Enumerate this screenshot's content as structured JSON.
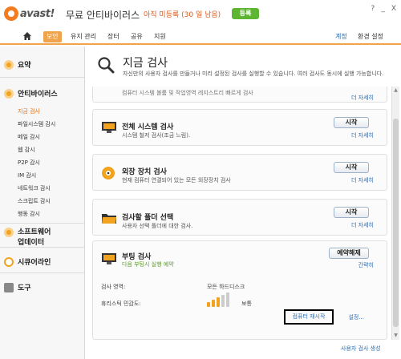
{
  "titlebar": {
    "logo_text": "avast!",
    "app_title": "무료 안티바이러스",
    "trial_text": "아직 미등록 (30 일 남음)",
    "register_label": "등록",
    "win_buttons": [
      "?",
      "_",
      "X"
    ]
  },
  "nav": {
    "items": [
      "보안",
      "유지 관리",
      "장터",
      "공유",
      "지원"
    ],
    "right_links": [
      "계정",
      "환경 설정"
    ]
  },
  "sidebar": {
    "summary_label": "요약",
    "antivirus_label": "안티바이러스",
    "antivirus_items": [
      "지금 검사",
      "파일시스템 감시",
      "메일 감시",
      "웹 감시",
      "P2P 감시",
      "IM 감시",
      "네트워크 감시",
      "스크립트 감시",
      "행동 감시"
    ],
    "software_update_label_1": "소프트웨어",
    "software_update_label_2": "업데이터",
    "sandbox_label": "시큐어라인",
    "tools_label": "도구"
  },
  "main": {
    "title": "지금 검사",
    "description": "자신만의 사용자 검사를 만들거나 미리 설정된 검사를 실행할 수 있습니다. 여러 검사도 동시에 실행 가능합니다.",
    "partial_card_text": "컴퓨터 시스템 볼륨 및 작업영역 레지스트리 빠르게 검사",
    "partial_card_link": "더 자세히",
    "cards": [
      {
        "title": "전체 시스템 검사",
        "desc": "시스템 철저 검사(조금 느림).",
        "button": "시작",
        "link": "더 자세히"
      },
      {
        "title": "외장 장치 검사",
        "desc": "현재 컴퓨터 연결되어 있는 모든 외장장치 검사",
        "button": "시작",
        "link": "더 자세히"
      },
      {
        "title": "검사할 폴더 선택",
        "desc": "사용자 선택 폴더에 대한 검사.",
        "button": "시작",
        "link": "더 자세히"
      }
    ],
    "boot": {
      "title": "부팅 검사",
      "desc": "다음 부팅시 실행 예약",
      "button": "예약해제",
      "link": "간략히",
      "area_label": "검사 영역:",
      "area_value": "모든 하드디스크",
      "sensitivity_label": "휴리스틱 민감도:",
      "sensitivity_value": "보통",
      "sensitivity_level": 0.6,
      "restart_link": "컴퓨터 재시작",
      "settings_link": "설정..."
    },
    "footer_link": "사용자 검사 생성"
  },
  "colors": {
    "accent": "#f1a34c",
    "trial": "#e05a1a",
    "register": "#5db531",
    "link": "#2a6db4"
  }
}
